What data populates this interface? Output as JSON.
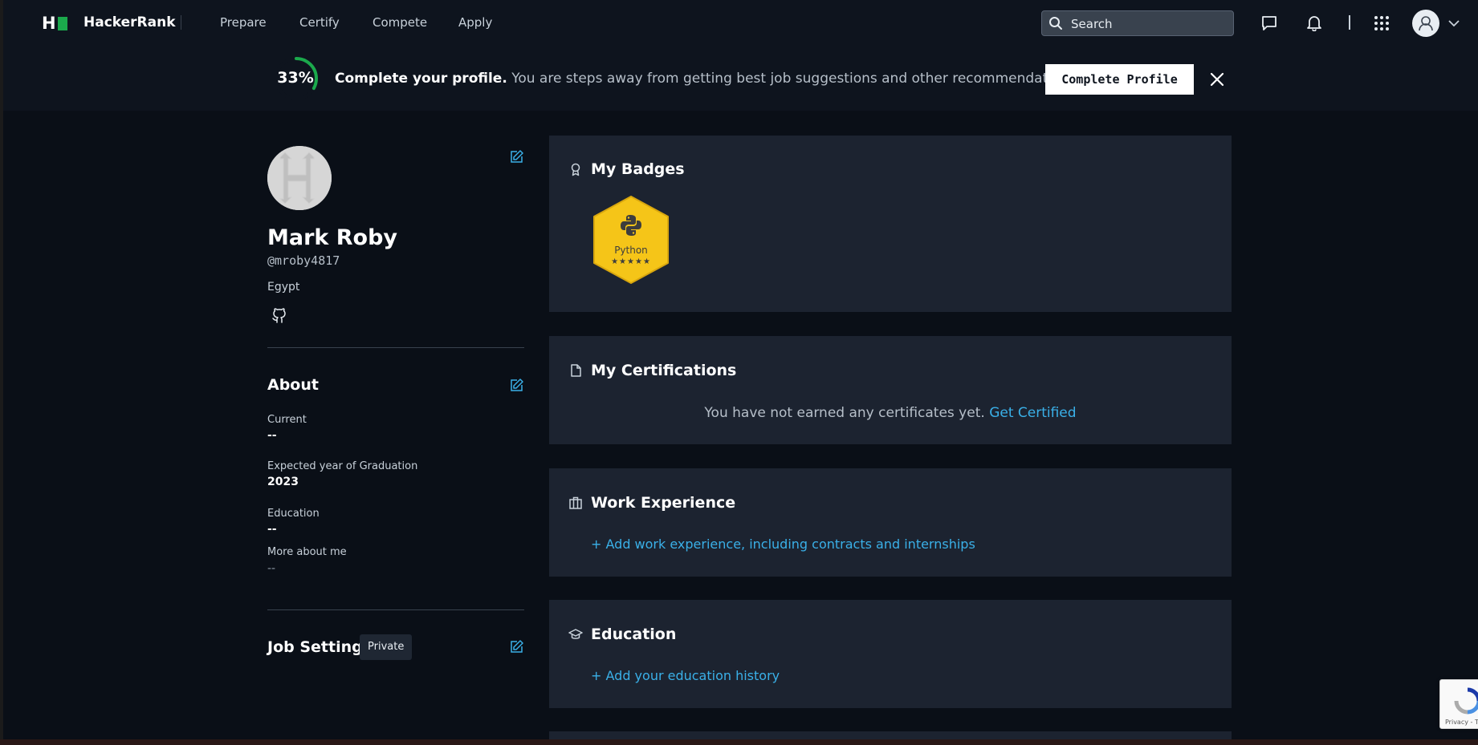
{
  "nav": {
    "brand": "HackerRank",
    "links": [
      "Prepare",
      "Certify",
      "Compete",
      "Apply"
    ],
    "search_placeholder": "Search"
  },
  "banner": {
    "percent_label": "33%",
    "percent_value": 0.33,
    "bold_text": "Complete your profile.",
    "text": " You are steps away from getting best job suggestions and other recommendations.",
    "button_label": "Complete Profile"
  },
  "profile": {
    "name": "Mark Roby",
    "handle": "@mroby4817",
    "country": "Egypt"
  },
  "about": {
    "title": "About",
    "fields": [
      {
        "label": "Current",
        "value": "--"
      },
      {
        "label": "Expected year of Graduation",
        "value": "2023"
      },
      {
        "label": "Education",
        "value": "--"
      },
      {
        "label": "More about me",
        "value": "--"
      }
    ]
  },
  "job_settings": {
    "title": "Job Settings",
    "visibility": "Private"
  },
  "cards": {
    "badges": {
      "title": "My Badges",
      "badge_name": "Python",
      "badge_stars": "★★★★★"
    },
    "certifications": {
      "title": "My Certifications",
      "message": "You have not earned any certificates yet.",
      "link": "Get Certified"
    },
    "work": {
      "title": "Work Experience",
      "link": "+ Add work experience, including contracts and internships"
    },
    "education": {
      "title": "Education",
      "link": "+ Add your education history"
    }
  },
  "recaptcha": {
    "text": "Privacy - Te"
  },
  "colors": {
    "accent_green": "#1ba94c",
    "link_blue": "#3ab0e8",
    "card_bg": "#1c2330",
    "page_bg": "#0a0f17",
    "badge_gold": "#f5c518"
  },
  "icons": [
    "search-icon",
    "chat-icon",
    "bell-icon",
    "apps-grid-icon",
    "user-avatar-icon",
    "chevron-down-icon",
    "close-icon",
    "edit-icon",
    "github-icon",
    "award-icon",
    "document-icon",
    "briefcase-icon",
    "graduation-cap-icon",
    "python-icon"
  ]
}
